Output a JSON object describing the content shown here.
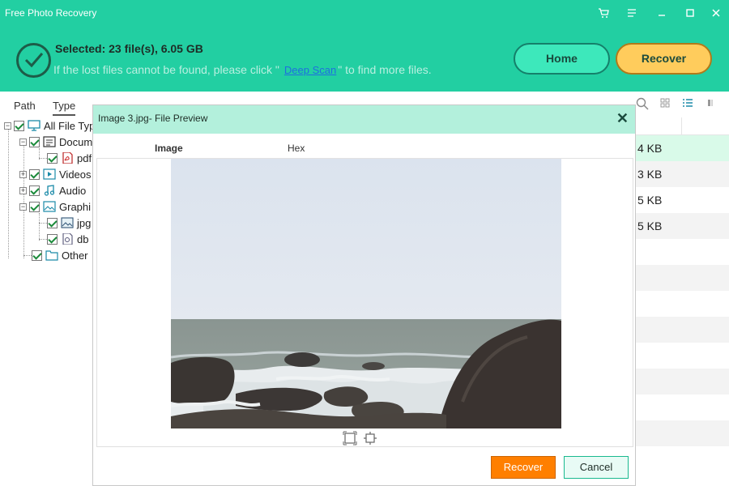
{
  "app": {
    "title": "Free Photo Recovery"
  },
  "window_controls": [
    "cart-icon",
    "menu-icon",
    "minimize-icon",
    "maximize-icon",
    "close-icon"
  ],
  "status": {
    "selected": "Selected: 23 file(s), 6.05 GB",
    "hint_before": "If the lost files cannot be found, please click \"",
    "hint_link": "Deep Scan",
    "hint_after": "\" to find more files."
  },
  "header_buttons": {
    "home": "Home",
    "recover": "Recover"
  },
  "left_tabs": {
    "path": "Path",
    "type": "Type"
  },
  "tree": {
    "all": "All File Typ",
    "documents": "Docum",
    "pdf": "pdf",
    "videos": "Videos",
    "audio": "Audio",
    "graphics": "Graphi",
    "jpg": "jpg",
    "db": "db",
    "other": "Other"
  },
  "sizes": [
    "4 KB",
    "3 KB",
    "5 KB",
    "5 KB"
  ],
  "dialog": {
    "title": "Image 3.jpg- File Preview",
    "tab_image": "Image",
    "tab_hex": "Hex",
    "recover": "Recover",
    "cancel": "Cancel"
  },
  "colors": {
    "header_bg": "#22cfa2",
    "dialog_title_bg": "#b3f0dc",
    "recover_orange": "#ff7f00",
    "recover_yellow": "#ffcc5c"
  }
}
